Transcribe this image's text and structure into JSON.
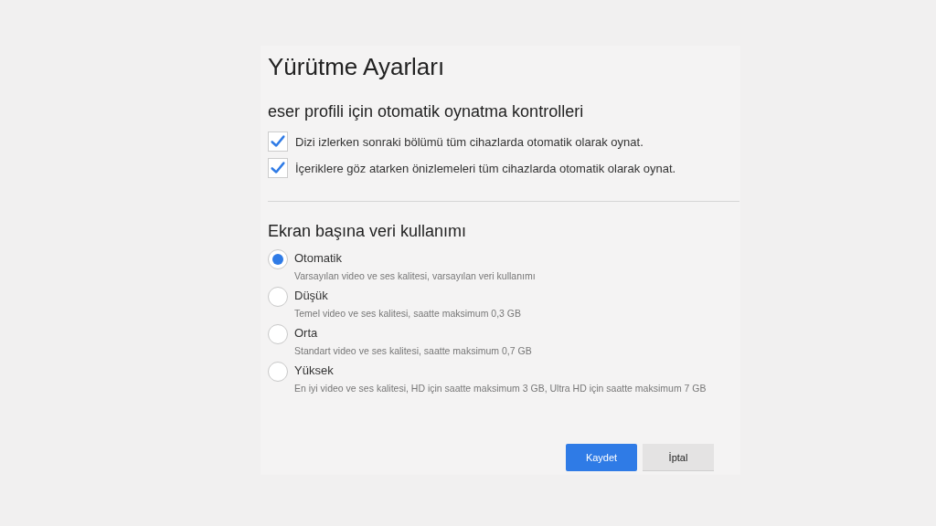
{
  "title": "Yürütme Ayarları",
  "autoplay": {
    "heading": "eser profili için otomatik oynatma kontrolleri",
    "options": [
      {
        "label": "Dizi izlerken sonraki bölümü tüm cihazlarda otomatik olarak oynat.",
        "checked": true
      },
      {
        "label": "İçeriklere göz atarken önizlemeleri tüm cihazlarda otomatik olarak oynat.",
        "checked": true
      }
    ]
  },
  "data_usage": {
    "heading": "Ekran başına veri kullanımı",
    "options": [
      {
        "label": "Otomatik",
        "description": "Varsayılan video ve ses kalitesi, varsayılan veri kullanımı",
        "selected": true
      },
      {
        "label": "Düşük",
        "description": "Temel video ve ses kalitesi, saatte maksimum 0,3 GB",
        "selected": false
      },
      {
        "label": "Orta",
        "description": "Standart video ve ses kalitesi, saatte maksimum 0,7 GB",
        "selected": false
      },
      {
        "label": "Yüksek",
        "description": "En iyi video ve ses kalitesi, HD için saatte maksimum 3 GB, Ultra HD için saatte maksimum 7 GB",
        "selected": false
      }
    ]
  },
  "buttons": [
    {
      "label": "Kaydet",
      "kind": "primary"
    },
    {
      "label": "İptal",
      "kind": "secondary"
    }
  ]
}
